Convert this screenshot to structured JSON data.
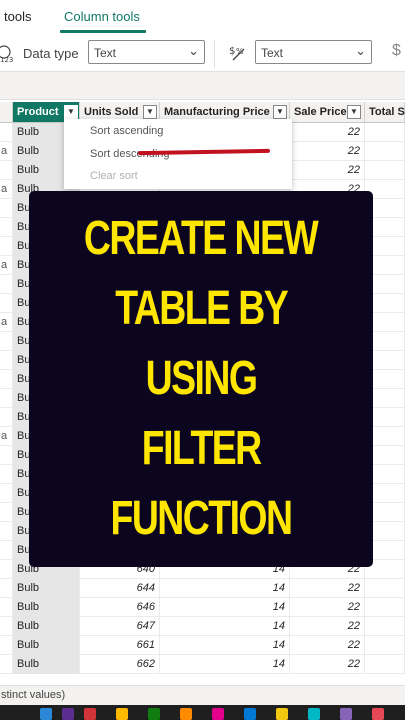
{
  "ribbon": {
    "tabs": [
      {
        "label": "tools"
      },
      {
        "label": "Column tools"
      }
    ],
    "data_type_label": "Data type",
    "data_type_value": "Text",
    "format_value": "Text"
  },
  "table": {
    "headers": [
      "Product",
      "Units Sold",
      "Manufacturing Price",
      "Sale Price",
      "Total Sa"
    ],
    "leading_cells": [
      "",
      "a",
      "",
      "a",
      "",
      "",
      "",
      "a",
      "",
      "",
      "a",
      "",
      "",
      "",
      "",
      "",
      "a",
      "",
      "",
      "",
      "",
      "",
      "",
      "",
      "",
      "",
      "",
      "",
      ""
    ],
    "rows": [
      {
        "product": "Bulb",
        "units": "",
        "mfg": "",
        "sale": "22"
      },
      {
        "product": "Bulb",
        "units": "",
        "mfg": "",
        "sale": "22"
      },
      {
        "product": "Bulb",
        "units": "",
        "mfg": "",
        "sale": "22"
      },
      {
        "product": "Bulb",
        "units": "",
        "mfg": "",
        "sale": "22"
      },
      {
        "product": "Bulb",
        "units": "",
        "mfg": "",
        "sale": ""
      },
      {
        "product": "Bulb",
        "units": "",
        "mfg": "",
        "sale": ""
      },
      {
        "product": "Bulb",
        "units": "",
        "mfg": "",
        "sale": ""
      },
      {
        "product": "Bulb",
        "units": "",
        "mfg": "",
        "sale": ""
      },
      {
        "product": "Bulb",
        "units": "",
        "mfg": "",
        "sale": ""
      },
      {
        "product": "Bulb",
        "units": "",
        "mfg": "",
        "sale": ""
      },
      {
        "product": "Bulb",
        "units": "",
        "mfg": "",
        "sale": ""
      },
      {
        "product": "Bulb",
        "units": "",
        "mfg": "",
        "sale": ""
      },
      {
        "product": "Bulb",
        "units": "",
        "mfg": "",
        "sale": ""
      },
      {
        "product": "Bulb",
        "units": "",
        "mfg": "",
        "sale": ""
      },
      {
        "product": "Bulb",
        "units": "",
        "mfg": "",
        "sale": ""
      },
      {
        "product": "Bulb",
        "units": "",
        "mfg": "",
        "sale": ""
      },
      {
        "product": "Bulb",
        "units": "",
        "mfg": "",
        "sale": ""
      },
      {
        "product": "Bulb",
        "units": "",
        "mfg": "",
        "sale": ""
      },
      {
        "product": "Bulb",
        "units": "",
        "mfg": "",
        "sale": ""
      },
      {
        "product": "Bulb",
        "units": "",
        "mfg": "",
        "sale": ""
      },
      {
        "product": "Bulb",
        "units": "",
        "mfg": "",
        "sale": ""
      },
      {
        "product": "Bulb",
        "units": "",
        "mfg": "",
        "sale": ""
      },
      {
        "product": "Bulb",
        "units": "",
        "mfg": "",
        "sale": ""
      },
      {
        "product": "Bulb",
        "units": "640",
        "mfg": "14",
        "sale": "22"
      },
      {
        "product": "Bulb",
        "units": "644",
        "mfg": "14",
        "sale": "22"
      },
      {
        "product": "Bulb",
        "units": "646",
        "mfg": "14",
        "sale": "22"
      },
      {
        "product": "Bulb",
        "units": "647",
        "mfg": "14",
        "sale": "22"
      },
      {
        "product": "Bulb",
        "units": "661",
        "mfg": "14",
        "sale": "22"
      },
      {
        "product": "Bulb",
        "units": "662",
        "mfg": "14",
        "sale": "22"
      }
    ]
  },
  "sort_menu": {
    "items": [
      "Sort ascending",
      "Sort descending",
      "Clear sort"
    ]
  },
  "overlay": {
    "lines": [
      "CREATE NEW",
      "TABLE BY",
      "USING",
      "FILTER",
      "FUNCTION"
    ]
  },
  "status_bar": {
    "text": "stinct values)"
  },
  "colors": {
    "accent": "#117865",
    "overlay_bg": "#0c0520",
    "overlay_text": "#ffe600",
    "highlight_mark": "#c1121f"
  }
}
